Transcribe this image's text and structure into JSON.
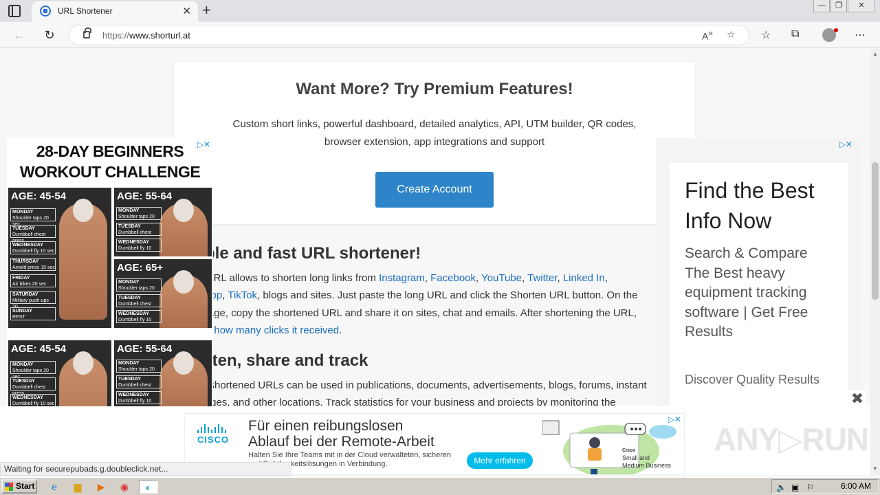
{
  "browser": {
    "tab_title": "URL Shortener",
    "tab_close": "✕",
    "new_tab": "+",
    "url_scheme": "https://",
    "url_host": "www.shorturl.at",
    "win_min": "—",
    "win_restore": "❐",
    "win_close": "✕"
  },
  "premium": {
    "title": "Want More? Try Premium Features!",
    "text": "Custom short links, powerful dashboard, detailed analytics, API, UTM builder, QR codes, browser extension, app integrations and support",
    "button": "Create Account"
  },
  "section1": {
    "title": "Simple and fast URL shortener!",
    "line1_start": "ShortURL allows to shorten long links from",
    "links_line1": [
      "Instagram",
      "Facebook",
      "YouTube",
      "Twitter",
      "Linked In"
    ],
    "links_line2": [
      "WhatsApp",
      "TikTok"
    ],
    "line2_rest": ", blogs and sites. Just paste the long URL and click the Shorten URL button. On the",
    "line3": "next page, copy the shortened URL and share it on sites, chat and emails. After shortening the URL,",
    "line4_start": "check",
    "line4_link": "how many clicks it received",
    "line4_end": "."
  },
  "section2": {
    "title": "Shorten, share and track",
    "line1": "Your shortened URLs can be used in publications, documents, advertisements, blogs, forums, instant",
    "line2": "messages, and other locations. Track statistics for your business and projects by monitoring the"
  },
  "left_ad": {
    "headline_line1": "28-DAY BEGINNERS",
    "headline_line2": "WORKOUT CHALLENGE",
    "choices": "▷✕",
    "tiles": [
      {
        "age": "AGE: 45-54",
        "rows": [
          {
            "day": "MONDAY",
            "task": "Shoulder taps 20 sec"
          },
          {
            "day": "TUESDAY",
            "task": "Dumbbell chest press"
          },
          {
            "day": "WEDNESDAY",
            "task": "Dumbbell fly 10 sec"
          },
          {
            "day": "THURSDAY",
            "task": "Arnold press 15 sec"
          },
          {
            "day": "FRIDAY",
            "task": "Air bikes 20 sec"
          },
          {
            "day": "SATURDAY",
            "task": "Military push-ups 20"
          },
          {
            "day": "SUNDAY",
            "task": "REST"
          }
        ]
      },
      {
        "age": "AGE: 55-64",
        "rows": [
          {
            "day": "MONDAY",
            "task": "Shoulder taps 20"
          },
          {
            "day": "TUESDAY",
            "task": "Dumbbell chest"
          },
          {
            "day": "WEDNESDAY",
            "task": "Dumbbell fly 10"
          }
        ]
      },
      {
        "age": "AGE: 65+",
        "rows": [
          {
            "day": "MONDAY",
            "task": "Shoulder taps 20"
          },
          {
            "day": "TUESDAY",
            "task": "Dumbbell chest"
          },
          {
            "day": "WEDNESDAY",
            "task": "Dumbbell fly 10"
          }
        ]
      },
      {
        "age": "AGE: 45-54",
        "rows": [
          {
            "day": "MONDAY",
            "task": "Shoulder taps 20 sec"
          },
          {
            "day": "TUESDAY",
            "task": "Dumbbell chest press"
          },
          {
            "day": "WEDNESDAY",
            "task": "Dumbbell fly 10 sec"
          }
        ]
      },
      {
        "age": "AGE: 55-64",
        "rows": [
          {
            "day": "MONDAY",
            "task": "Shoulder taps 20"
          },
          {
            "day": "TUESDAY",
            "task": "Dumbbell chest"
          },
          {
            "day": "WEDNESDAY",
            "task": "Dumbbell fly 10"
          }
        ]
      }
    ]
  },
  "right_ad": {
    "choices": "▷✕",
    "headline": "Find the Best Info Now",
    "body": "Search & Compare The Best heavy equipment tracking software | Get Free Results",
    "sub": "Discover Quality Results"
  },
  "banner": {
    "brand": "CISCO",
    "headline_line1": "Für einen reibungslosen",
    "headline_line2": "Ablauf bei der Remote-Arbeit",
    "sub_line1": "Halten Sie Ihre Teams mit in der Cloud verwalteten, sicheren",
    "sub_line2": "und Sichtbarkeitslösungen in Verbindung.",
    "cta": "Mehr erfahren",
    "tag_brand": "Cisco",
    "tag_line1": "Small and",
    "tag_line2": "Medium Business",
    "choices": "▷✕",
    "close": "✖"
  },
  "status": "Waiting for securepubads.g.doubleclick.net...",
  "watermark": "ANY▷RUN",
  "taskbar": {
    "start": "Start",
    "clock": "6:00 AM"
  }
}
